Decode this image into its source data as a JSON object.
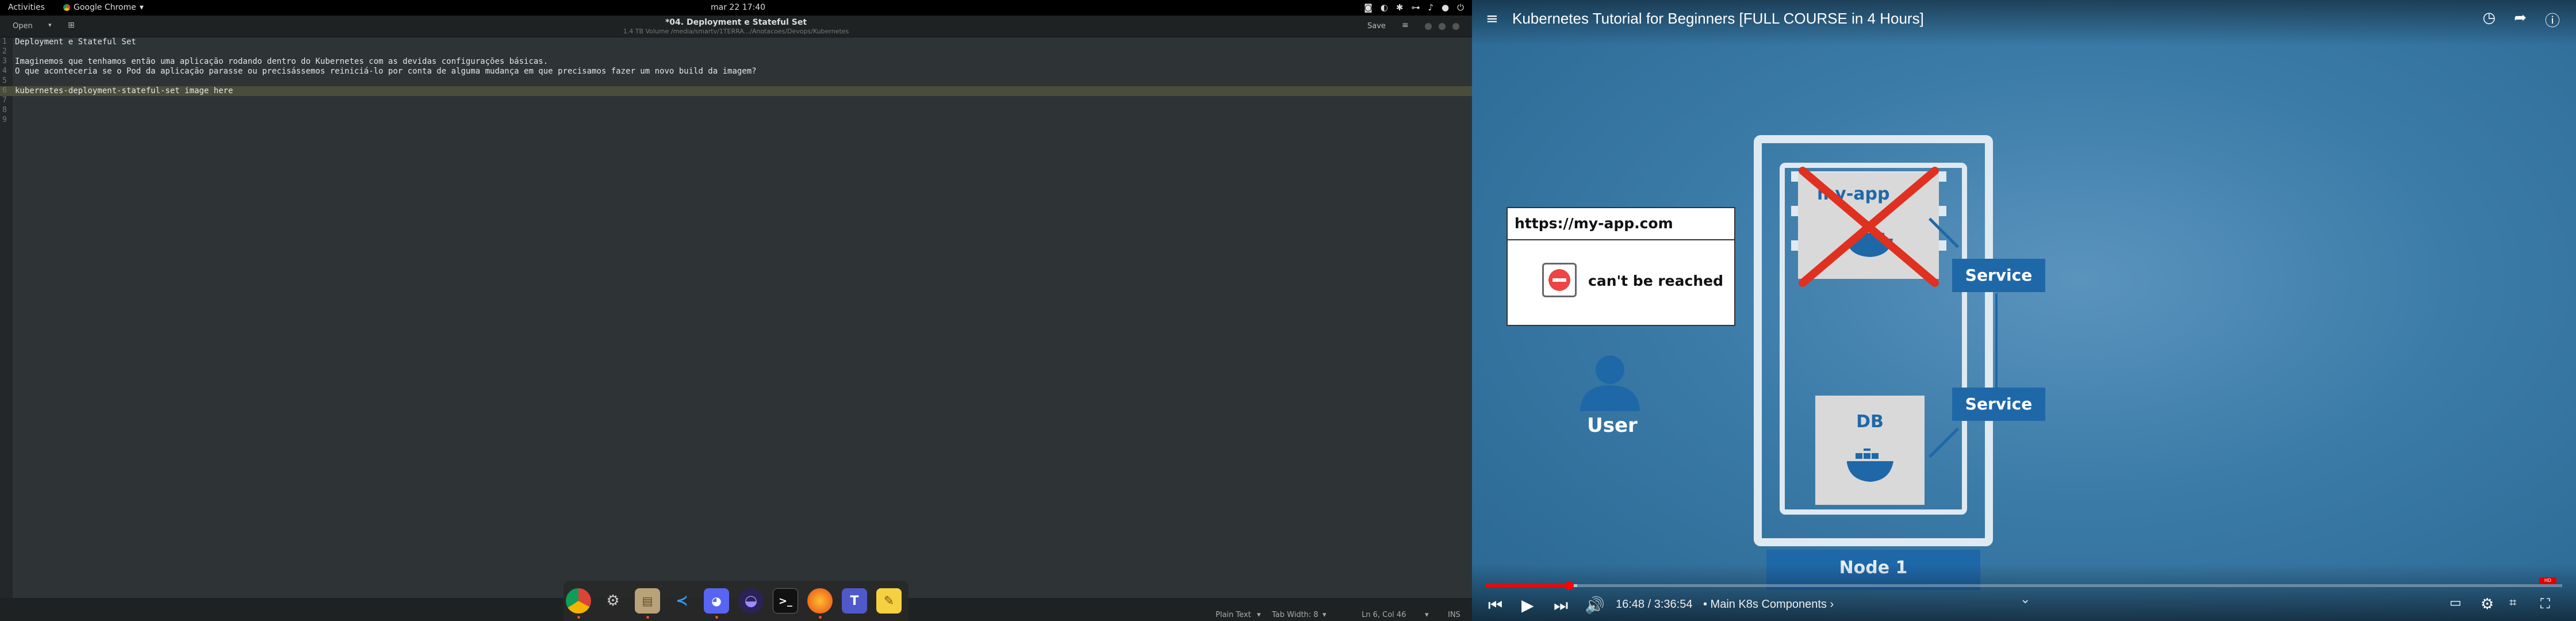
{
  "topbar": {
    "activities": "Activities",
    "app_name": "Google Chrome",
    "clock": "mar 22  17:40"
  },
  "gedit": {
    "open_label": "Open",
    "title": "*04. Deployment e Stateful Set",
    "subtitle": "1.4 TB Volume /media/smartv/1TERRA.../Anotacoes/Devops/Kubernetes",
    "save_label": "Save",
    "lines": [
      {
        "num": "1",
        "text": "Deployment e Stateful Set"
      },
      {
        "num": "2",
        "text": ""
      },
      {
        "num": "3",
        "text": "Imaginemos que tenhamos então uma aplicação rodando dentro do Kubernetes com as devidas configurações básicas."
      },
      {
        "num": "4",
        "text": "O que aconteceria se o Pod da aplicação parasse ou precisássemos reiniciá-lo por conta de alguma mudança em que precisamos fazer um novo build da imagem?"
      },
      {
        "num": "5",
        "text": ""
      },
      {
        "num": "6",
        "text": "kubernetes-deployment-stateful-set image here"
      },
      {
        "num": "7",
        "text": ""
      },
      {
        "num": "8",
        "text": ""
      },
      {
        "num": "9",
        "text": ""
      }
    ],
    "status": {
      "language": "Plain Text",
      "tab_width": "Tab Width: 8",
      "position": "Ln 6, Col 46",
      "mode": "INS"
    }
  },
  "dock": {
    "apps": [
      "chrome-icon",
      "settings-icon",
      "files-icon",
      "vscode-icon",
      "discord-icon",
      "eclipse-icon",
      "terminal-icon",
      "firefox-icon",
      "teams-icon",
      "notes-icon"
    ]
  },
  "player": {
    "title": "Kubernetes Tutorial for Beginners [FULL COURSE in 4 Hours]",
    "diagram": {
      "url": "https://my-app.com",
      "error": "can't be reached",
      "user_label": "User",
      "app_label": "my-app",
      "db_label": "DB",
      "service_1": "Service",
      "service_2": "Service",
      "node_label": "Node 1"
    },
    "time": "16:48 / 3:36:54",
    "chapter": "• Main K8s Components ›",
    "progress_fraction": 0.0776,
    "buffer_fraction": 0.085,
    "colors": {
      "accent": "#ff0000",
      "diagram_blue": "#1f68a8",
      "background": "#3b7ba8"
    }
  }
}
